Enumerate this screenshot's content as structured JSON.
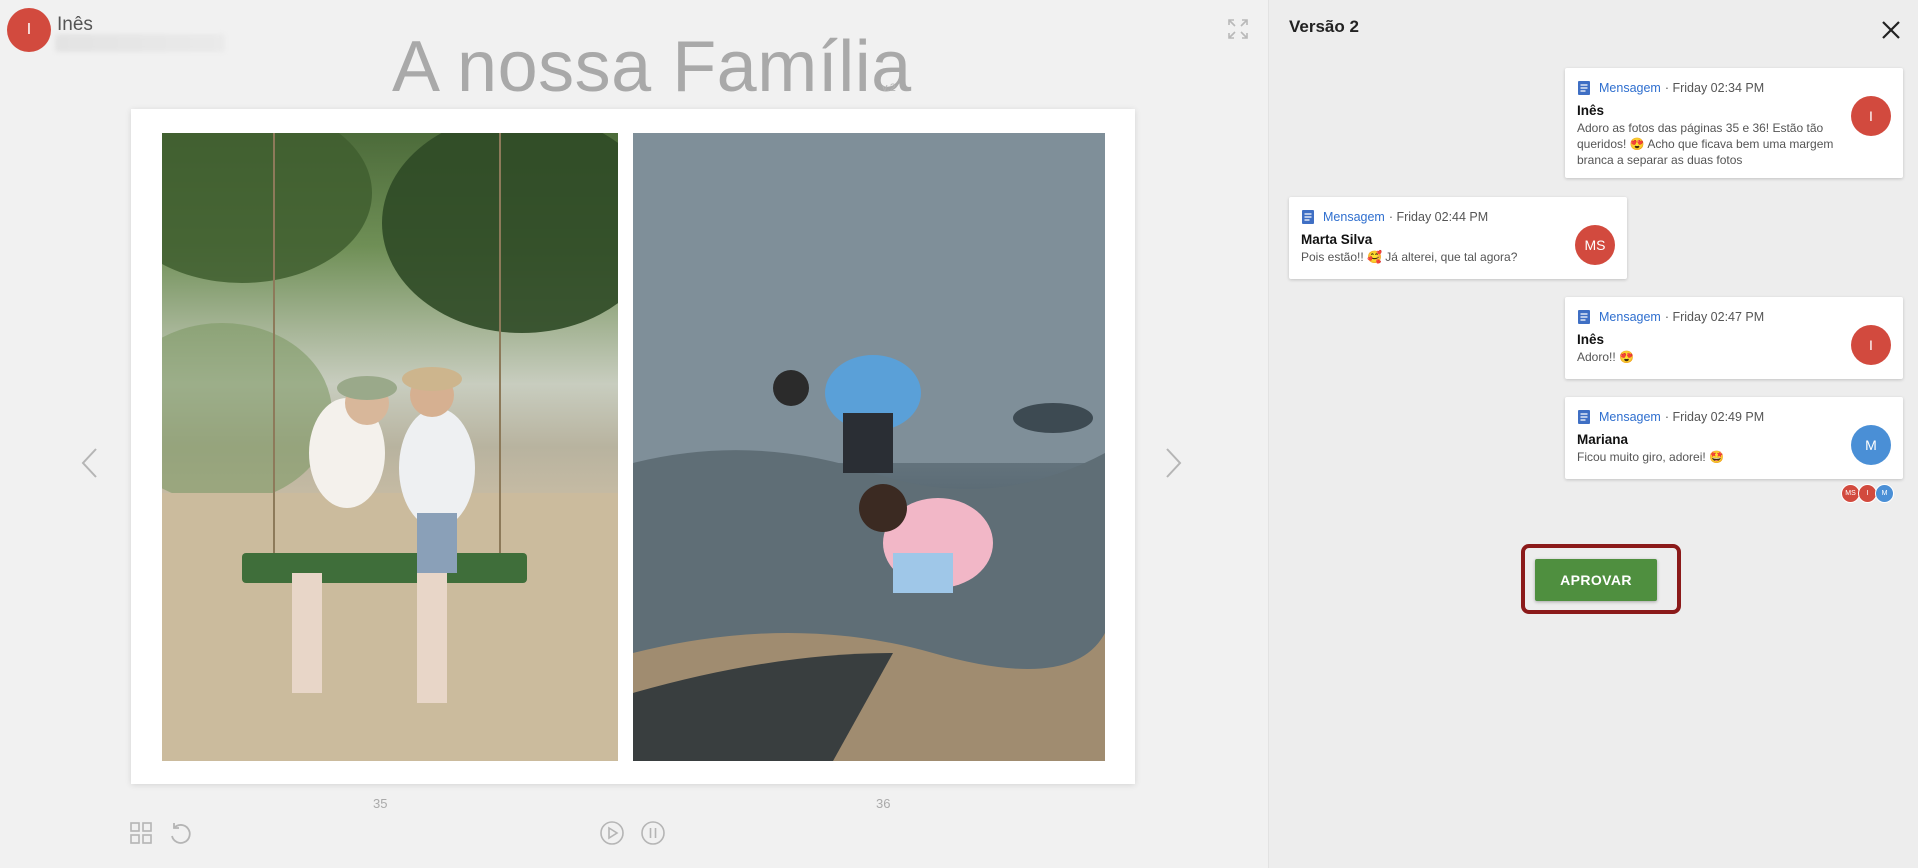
{
  "viewer": {
    "user": {
      "name": "Inês",
      "avatar_initial": "I",
      "avatar_color": "#d24a3e"
    },
    "album_title": "A nossa Família",
    "version_tag": "v.2",
    "pages": {
      "left": "35",
      "right": "36"
    },
    "photos": {
      "left": "children-on-swing-photo",
      "right": "children-at-beach-photo"
    },
    "icons": [
      "fullscreen-icon",
      "chevron-left-icon",
      "chevron-right-icon",
      "grid-icon",
      "undo-icon",
      "play-icon",
      "pause-icon"
    ]
  },
  "panel": {
    "title": "Versão 2",
    "messages": [
      {
        "type": "Mensagem",
        "time": "· Friday 02:34 PM",
        "author": "Inês",
        "text": "Adoro as fotos das páginas 35 e 36! Estão tão queridos! 😍 Acho que ficava bem uma margem branca a separar as duas fotos",
        "avatar": "I",
        "avatar_color": "#d24a3e"
      },
      {
        "type": "Mensagem",
        "time": "· Friday 02:44 PM",
        "author": "Marta Silva",
        "text": "Pois estão!! 🥰 Já alterei, que tal agora?",
        "avatar": "MS",
        "avatar_color": "#d24a3e"
      },
      {
        "type": "Mensagem",
        "time": "· Friday 02:47 PM",
        "author": "Inês",
        "text": "Adoro!! 😍",
        "avatar": "I",
        "avatar_color": "#d24a3e"
      },
      {
        "type": "Mensagem",
        "time": "· Friday 02:49 PM",
        "author": "Mariana",
        "text": "Ficou muito giro, adorei! 🤩",
        "avatar": "M",
        "avatar_color": "#4a8fd6"
      }
    ],
    "readers": [
      {
        "initials": "MS",
        "color": "#d24a3e"
      },
      {
        "initials": "I",
        "color": "#d24a3e"
      },
      {
        "initials": "M",
        "color": "#4a8fd6"
      }
    ],
    "approve_label": "APROVAR",
    "approve_color": "#4f8f3f",
    "highlight_color": "#8b1a1a"
  }
}
